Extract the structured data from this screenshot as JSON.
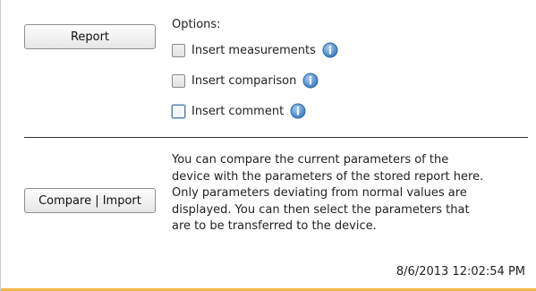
{
  "report_section": {
    "report_button_label": "Report",
    "options_title": "Options:",
    "options": [
      {
        "label": "Insert measurements",
        "checked": false,
        "info_icon": "info-icon"
      },
      {
        "label": "Insert comparison",
        "checked": false,
        "info_icon": "info-icon"
      },
      {
        "label": "Insert comment",
        "checked": false,
        "info_icon": "info-icon"
      }
    ]
  },
  "compare_section": {
    "compare_button_label": "Compare | Import",
    "description_lines": [
      "You can compare the current parameters of the",
      "device with the parameters of the stored report here.",
      "Only parameters deviating from normal values are",
      "displayed. You can then select the parameters that",
      "are to be transferred to the device."
    ]
  },
  "timestamp": "8/6/2013 12:02:54 PM",
  "colors": {
    "accent_bottom_line": "#f0b447",
    "info_icon": "#4a86c9"
  }
}
